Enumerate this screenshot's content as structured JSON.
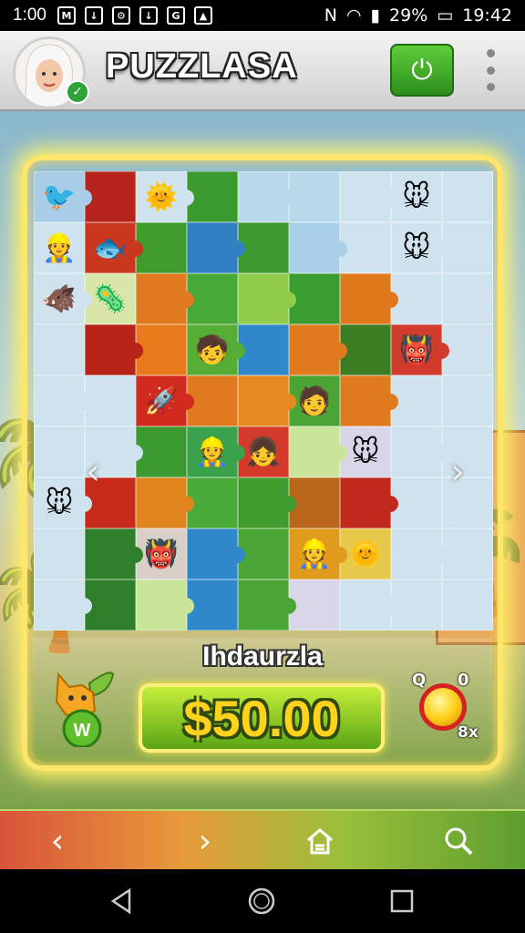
{
  "status_bar": {
    "time": "1:00",
    "battery": "29%",
    "clock": "19:42",
    "notification_icons": [
      "gmail-icon",
      "download-icon",
      "settings-icon",
      "download-icon",
      "g-icon",
      "image-icon"
    ]
  },
  "header": {
    "app_title": "PUZZLASA"
  },
  "board": {
    "rows": 9,
    "cols": 9,
    "colors": [
      [
        "#a9cde6",
        "#b7241b",
        "#cfe3ee",
        "#3a9a2e",
        "#b8d9ea",
        "#b8d9ea",
        "#cfe3ee",
        "#cfe3ee",
        "#cfe3ee"
      ],
      [
        "#cfe3ee",
        "#c9381e",
        "#3e9b2c",
        "#2f7fc1",
        "#3c9a2e",
        "#a9d0e8",
        "#cfe3ee",
        "#cfe3ee",
        "#cfe3ee"
      ],
      [
        "#cfe3ee",
        "#d8e7a9",
        "#e07a1e",
        "#47a936",
        "#8fcc4a",
        "#3b9d2f",
        "#e0791c",
        "#cfe3ee",
        "#cfe3ee"
      ],
      [
        "#cfe3ee",
        "#b92418",
        "#e87a1c",
        "#55ad34",
        "#2f88c9",
        "#e07a1e",
        "#3c7c22",
        "#d03b2c",
        "#cfe3ee"
      ],
      [
        "#cfe3ee",
        "#cfe3ee",
        "#d12a1e",
        "#e07a1e",
        "#e88a22",
        "#4aa534",
        "#e07a1e",
        "#cfe3ee",
        "#cfe3ee"
      ],
      [
        "#cfe3ee",
        "#cfe3ee",
        "#3a9a2e",
        "#3aa24a",
        "#d33a2a",
        "#c8e59a",
        "#d8d6e8",
        "#cfe3ee",
        "#cfe3ee"
      ],
      [
        "#cfe3ee",
        "#c82a1a",
        "#e0841e",
        "#4bab38",
        "#3e9b2c",
        "#b8661a",
        "#c22a1e",
        "#cfe3ee",
        "#cfe3ee"
      ],
      [
        "#cfe3ee",
        "#2f7f2a",
        "#d8d0c8",
        "#2f88c9",
        "#4aa534",
        "#e09a1c",
        "#e8c84a",
        "#cfe3ee",
        "#cfe3ee"
      ],
      [
        "#cfe3ee",
        "#2f7f2a",
        "#c8e59a",
        "#2f88c9",
        "#4aa534",
        "#d8d6e8",
        "#cfe3ee",
        "#cfe3ee",
        "#cfe3ee"
      ]
    ],
    "characters": [
      {
        "row": 0,
        "col": 0,
        "emoji": "🐦"
      },
      {
        "row": 0,
        "col": 2,
        "emoji": "🌞"
      },
      {
        "row": 0,
        "col": 7,
        "emoji": "🐭"
      },
      {
        "row": 1,
        "col": 0,
        "emoji": "👷"
      },
      {
        "row": 1,
        "col": 1,
        "emoji": "🐟"
      },
      {
        "row": 1,
        "col": 7,
        "emoji": "🐭"
      },
      {
        "row": 2,
        "col": 0,
        "emoji": "🐗"
      },
      {
        "row": 2,
        "col": 1,
        "emoji": "🦠"
      },
      {
        "row": 3,
        "col": 3,
        "emoji": "🧒"
      },
      {
        "row": 3,
        "col": 7,
        "emoji": "👹"
      },
      {
        "row": 4,
        "col": 2,
        "emoji": "🚀"
      },
      {
        "row": 4,
        "col": 5,
        "emoji": "🧑"
      },
      {
        "row": 5,
        "col": 3,
        "emoji": "👷"
      },
      {
        "row": 5,
        "col": 4,
        "emoji": "👧"
      },
      {
        "row": 5,
        "col": 6,
        "emoji": "🐭"
      },
      {
        "row": 6,
        "col": 0,
        "emoji": "🐭"
      },
      {
        "row": 7,
        "col": 2,
        "emoji": "👹"
      },
      {
        "row": 7,
        "col": 5,
        "emoji": "👷"
      },
      {
        "row": 7,
        "col": 6,
        "emoji": "🌞"
      }
    ]
  },
  "panel": {
    "player_name": "Ihdaurzla",
    "amount": "$50.00",
    "q_label": "Q",
    "q_value": "0",
    "multiplier": "8x",
    "mascot_letter": "W"
  },
  "colors": {
    "accent_green": "#3fae2a",
    "frame_gold": "#ffe56a",
    "amount_text": "#ffd21e"
  }
}
